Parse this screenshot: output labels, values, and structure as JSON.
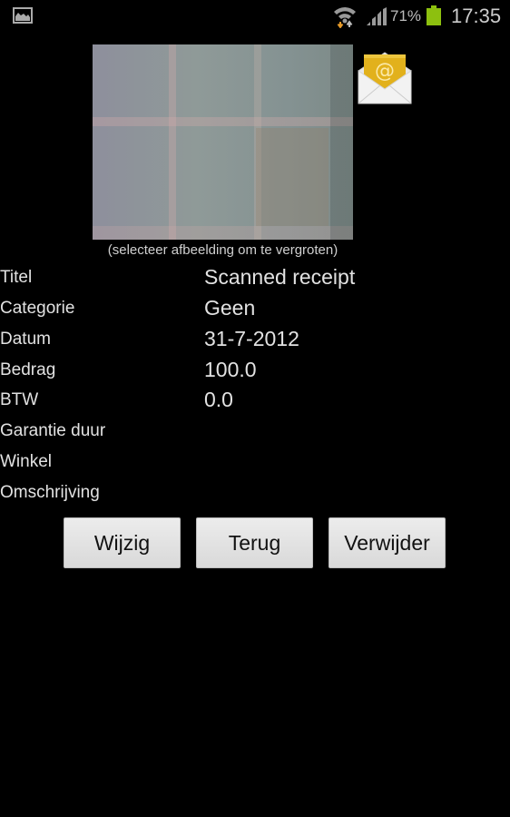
{
  "status_bar": {
    "notification_icon": "gallery-icon",
    "wifi_icon": "wifi-data-transfer-icon",
    "signal_icon": "cell-signal-icon",
    "battery_percent": "71%",
    "battery_level": 0.71,
    "battery_color": "#8dc00f",
    "time": "17:35"
  },
  "receipt": {
    "image_alt": "Scanned receipt photo",
    "image_caption": "(selecteer afbeelding om te vergroten)",
    "email_icon": "email-at-envelope-icon"
  },
  "fields": [
    {
      "label": "Titel",
      "value": "Scanned receipt"
    },
    {
      "label": "Categorie",
      "value": "Geen"
    },
    {
      "label": "Datum",
      "value": "31-7-2012"
    },
    {
      "label": "Bedrag",
      "value": "100.0"
    },
    {
      "label": "BTW",
      "value": "0.0"
    },
    {
      "label": "Garantie duur",
      "value": ""
    },
    {
      "label": "Winkel",
      "value": ""
    },
    {
      "label": "Omschrijving",
      "value": ""
    }
  ],
  "buttons": {
    "edit": "Wijzig",
    "back": "Terug",
    "delete": "Verwijder"
  }
}
